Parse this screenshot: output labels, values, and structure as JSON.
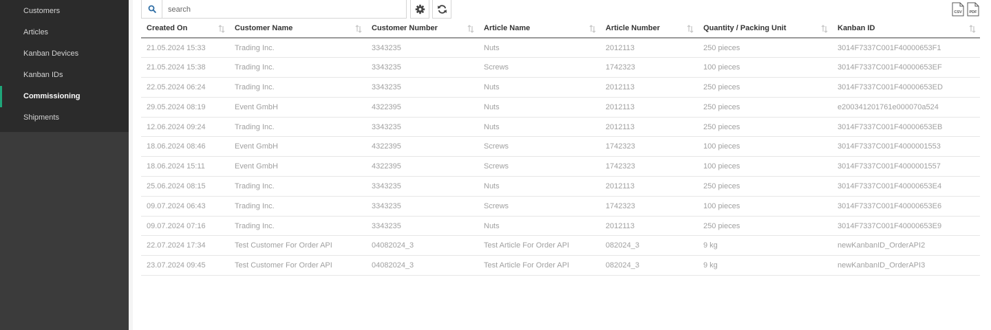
{
  "sidebar": {
    "items": [
      {
        "label": "Customers",
        "active": false
      },
      {
        "label": "Articles",
        "active": false
      },
      {
        "label": "Kanban Devices",
        "active": false
      },
      {
        "label": "Kanban IDs",
        "active": false
      },
      {
        "label": "Commissioning",
        "active": true
      },
      {
        "label": "Shipments",
        "active": false
      }
    ]
  },
  "toolbar": {
    "search_placeholder": "search",
    "search_value": "",
    "settings_icon": "gear-icon",
    "refresh_icon": "refresh-icon",
    "export_csv_label": "CSV",
    "export_pdf_label": "PDF"
  },
  "colors": {
    "accent": "#1fa67a",
    "sidebar_bg": "#3b3b3b",
    "sidebar_band": "#2b2b2b",
    "search_icon": "#2f6ea5"
  },
  "table": {
    "columns": [
      "Created On",
      "Customer Name",
      "Customer Number",
      "Article Name",
      "Article Number",
      "Quantity / Packing Unit",
      "Kanban ID"
    ],
    "rows": [
      [
        "21.05.2024 15:33",
        "Trading Inc.",
        "3343235",
        "Nuts",
        "2012113",
        "250 pieces",
        "3014F7337C001F40000653F1"
      ],
      [
        "21.05.2024 15:38",
        "Trading Inc.",
        "3343235",
        "Screws",
        "1742323",
        "100 pieces",
        "3014F7337C001F40000653EF"
      ],
      [
        "22.05.2024 06:24",
        "Trading Inc.",
        "3343235",
        "Nuts",
        "2012113",
        "250 pieces",
        "3014F7337C001F40000653ED"
      ],
      [
        "29.05.2024 08:19",
        "Event GmbH",
        "4322395",
        "Nuts",
        "2012113",
        "250 pieces",
        "e200341201761e000070a524"
      ],
      [
        "12.06.2024 09:24",
        "Trading Inc.",
        "3343235",
        "Nuts",
        "2012113",
        "250 pieces",
        "3014F7337C001F40000653EB"
      ],
      [
        "18.06.2024 08:46",
        "Event GmbH",
        "4322395",
        "Screws",
        "1742323",
        "100 pieces",
        "3014F7337C001F4000001553"
      ],
      [
        "18.06.2024 15:11",
        "Event GmbH",
        "4322395",
        "Screws",
        "1742323",
        "100 pieces",
        "3014F7337C001F4000001557"
      ],
      [
        "25.06.2024 08:15",
        "Trading Inc.",
        "3343235",
        "Nuts",
        "2012113",
        "250 pieces",
        "3014F7337C001F40000653E4"
      ],
      [
        "09.07.2024 06:43",
        "Trading Inc.",
        "3343235",
        "Screws",
        "1742323",
        "100 pieces",
        "3014F7337C001F40000653E6"
      ],
      [
        "09.07.2024 07:16",
        "Trading Inc.",
        "3343235",
        "Nuts",
        "2012113",
        "250 pieces",
        "3014F7337C001F40000653E9"
      ],
      [
        "22.07.2024 17:34",
        "Test Customer For Order API",
        "04082024_3",
        "Test Article For Order API",
        "082024_3",
        "9 kg",
        "newKanbanID_OrderAPI2"
      ],
      [
        "23.07.2024 09:45",
        "Test Customer For Order API",
        "04082024_3",
        "Test Article For Order API",
        "082024_3",
        "9 kg",
        "newKanbanID_OrderAPI3"
      ]
    ]
  }
}
